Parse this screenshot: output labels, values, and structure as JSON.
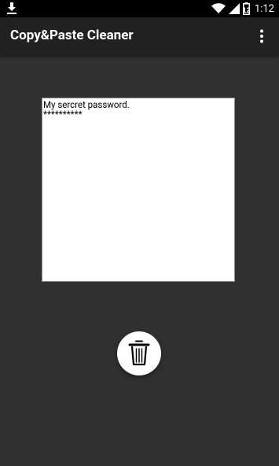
{
  "status_bar": {
    "time": "1:12",
    "battery_level": "12",
    "icons": [
      "download-icon",
      "wifi-icon",
      "signal-icon",
      "battery-icon"
    ]
  },
  "toolbar": {
    "title": "Copy&Paste Cleaner",
    "menu_icon": "more-vert-icon"
  },
  "clipboard": {
    "lines": [
      "My sercret password.",
      "**********"
    ]
  },
  "actions": {
    "delete_icon": "trash-icon"
  },
  "colors": {
    "background": "#303030",
    "toolbar": "#212121",
    "status_bar": "#000000",
    "panel": "#ffffff"
  }
}
